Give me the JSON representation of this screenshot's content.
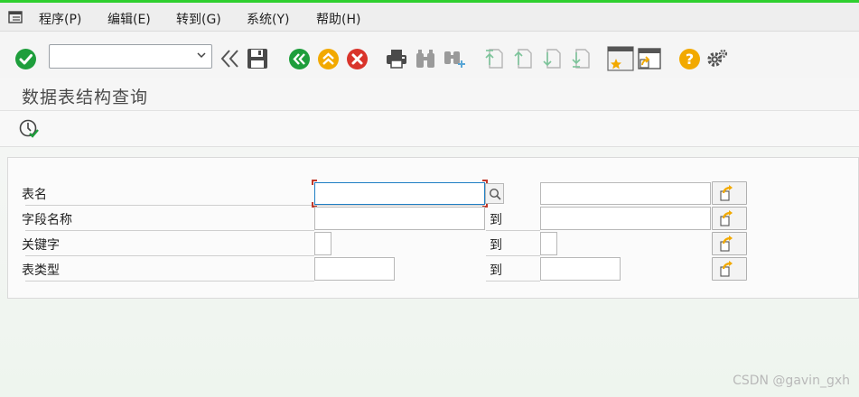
{
  "menu": {
    "items": [
      {
        "label": "程序(P)"
      },
      {
        "label": "编辑(E)"
      },
      {
        "label": "转到(G)"
      },
      {
        "label": "系统(Y)"
      },
      {
        "label": "帮助(H)"
      }
    ]
  },
  "toolbar": {
    "command_value": "",
    "icons": [
      "enter-check-icon",
      "command-dropdown",
      "collapse-left-icon",
      "save-icon",
      "back-icon",
      "exit-icon",
      "cancel-icon",
      "print-icon",
      "find-icon",
      "find-next-icon",
      "first-page-icon",
      "previous-page-icon",
      "next-page-icon",
      "last-page-icon",
      "create-session-icon",
      "shortcut-icon",
      "help-icon",
      "settings-icon"
    ]
  },
  "page": {
    "title": "数据表结构查询"
  },
  "form": {
    "rows": [
      {
        "label": "表名",
        "from_value": "",
        "to_label": "",
        "to_value": ""
      },
      {
        "label": "字段名称",
        "from_value": "",
        "to_label": "到",
        "to_value": ""
      },
      {
        "label": "关键字",
        "from_value": "",
        "to_label": "到",
        "to_value": ""
      },
      {
        "label": "表类型",
        "from_value": "",
        "to_label": "到",
        "to_value": ""
      }
    ]
  },
  "watermark": "CSDN @gavin_gxh",
  "colors": {
    "accent_green": "#2fcf2f",
    "check_green": "#1e9e3c",
    "cancel_red": "#d9342b",
    "help_yellow": "#f2a900",
    "focus_blue": "#1f7fc4"
  }
}
